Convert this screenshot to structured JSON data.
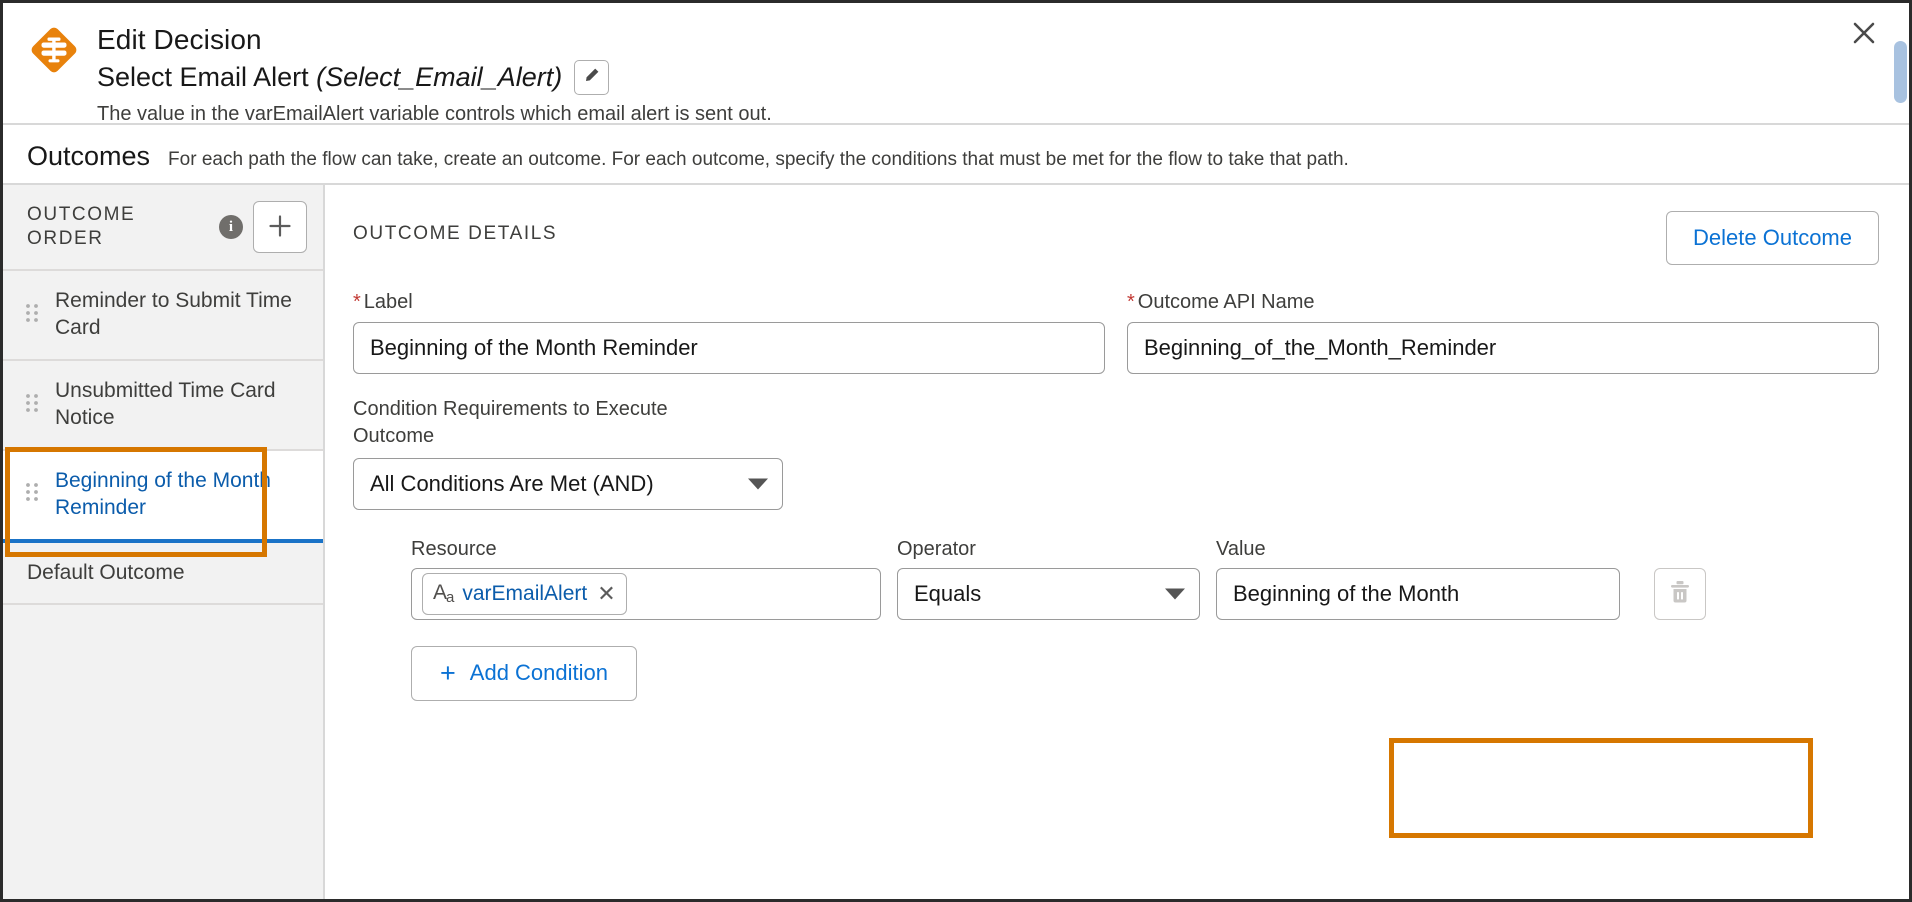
{
  "window": {
    "close_label": "✕"
  },
  "header": {
    "icon": "decision-diamond-icon",
    "title": "Edit Decision",
    "element_name": "Select Email Alert",
    "api_name": "(Select_Email_Alert)",
    "edit_icon": "pencil-icon",
    "description": "The value in the varEmailAlert variable controls which email alert is sent out."
  },
  "outcomes_banner": {
    "title": "Outcomes",
    "description": "For each path the flow can take, create an outcome. For each outcome, specify the conditions that must be met for the flow to take that path."
  },
  "sidebar": {
    "heading": "OUTCOME ORDER",
    "info_icon": "info-icon",
    "info_glyph": "i",
    "add_button_glyph": "+",
    "items": [
      {
        "label": "Reminder to Submit Time Card",
        "selected": false
      },
      {
        "label": "Unsubmitted Time Card Notice",
        "selected": false
      },
      {
        "label": "Beginning of the Month Reminder",
        "selected": true
      }
    ],
    "default_outcome": "Default Outcome"
  },
  "detail": {
    "section_title": "OUTCOME DETAILS",
    "delete_button": "Delete Outcome",
    "label_field": {
      "label": "Label",
      "required_marker": "*",
      "value": "Beginning of the Month Reminder"
    },
    "api_field": {
      "label": "Outcome API Name",
      "required_marker": "*",
      "value": "Beginning_of_the_Month_Reminder"
    },
    "condition_requirements": {
      "label": "Condition Requirements to Execute Outcome",
      "selected": "All Conditions Are Met (AND)"
    },
    "condition": {
      "resource_label": "Resource",
      "resource_pill": {
        "type_icon": "text-type-icon",
        "type_icon_glyph_main": "A",
        "type_icon_glyph_sub": "a",
        "name": "varEmailAlert",
        "remove_glyph": "✕"
      },
      "operator_label": "Operator",
      "operator_value": "Equals",
      "value_label": "Value",
      "value_text": "Beginning of the Month",
      "delete_condition_icon": "trash-icon"
    },
    "add_condition_button": {
      "plus": "+",
      "label": "Add Condition"
    }
  },
  "annotations": {
    "highlight_color": "#d67700",
    "targets": [
      "sidebar-selected-outcome",
      "condition-value-field"
    ]
  },
  "colors": {
    "accent_blue": "#0b72d4",
    "link_blue": "#0b5cab",
    "decision_orange": "#e8820c",
    "required_red": "#c23934",
    "sidebar_bg": "#f2f2f2"
  }
}
